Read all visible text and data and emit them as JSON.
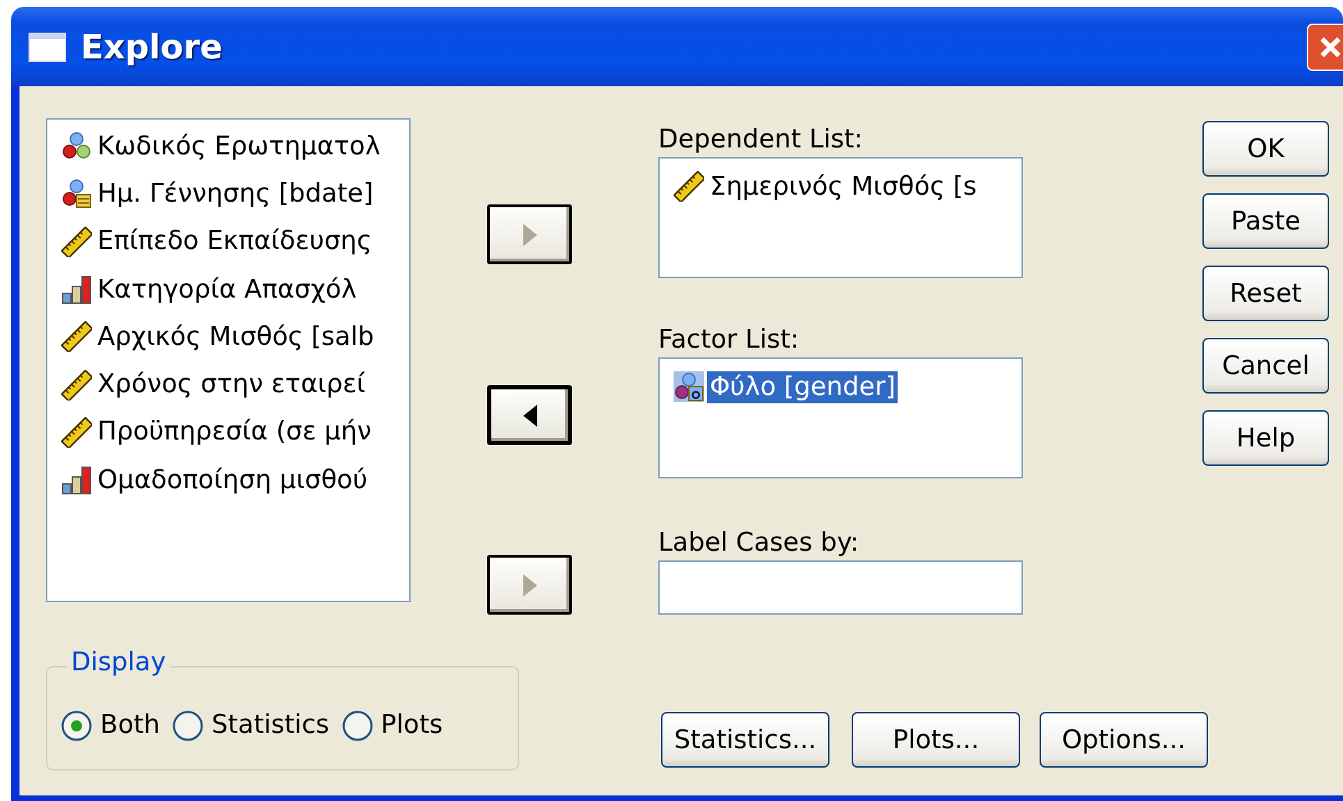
{
  "window": {
    "title": "Explore"
  },
  "source_list": {
    "items": [
      {
        "label": "Κωδικός Ερωτηματολ",
        "kind": "nominal"
      },
      {
        "label": "Ημ. Γέννησης [bdate]",
        "kind": "date"
      },
      {
        "label": "Επίπεδο Εκπαίδευσης",
        "kind": "scale"
      },
      {
        "label": "Κατηγορία Απασχόλ",
        "kind": "ordinal"
      },
      {
        "label": "Αρχικός Μισθός [salb",
        "kind": "scale"
      },
      {
        "label": "Χρόνος στην εταιρεί",
        "kind": "scale"
      },
      {
        "label": "Προϋπηρεσία (σε μήν",
        "kind": "scale"
      },
      {
        "label": "Ομαδοποίηση μισθού",
        "kind": "ordinal"
      }
    ]
  },
  "move_buttons": [
    {
      "kind": "right",
      "disabled": true,
      "default": false
    },
    {
      "kind": "left",
      "disabled": false,
      "default": true
    },
    {
      "kind": "right",
      "disabled": true,
      "default": false
    }
  ],
  "dependent_list": {
    "label": "Dependent List:",
    "items": [
      {
        "label": "Σημερινός Μισθός [s",
        "kind": "scale",
        "selected": false
      }
    ]
  },
  "factor_list": {
    "label": "Factor List:",
    "items": [
      {
        "label": "Φύλο [gender]",
        "kind": "string",
        "selected": true
      }
    ]
  },
  "label_cases": {
    "label": "Label Cases by:"
  },
  "display": {
    "label": "Display",
    "options": [
      {
        "label": "Both",
        "selected": true
      },
      {
        "label": "Statistics",
        "selected": false
      },
      {
        "label": "Plots",
        "selected": false
      }
    ]
  },
  "action_buttons": [
    "OK",
    "Paste",
    "Reset",
    "Cancel",
    "Help"
  ],
  "bottom_buttons": [
    "Statistics...",
    "Plots...",
    "Options..."
  ]
}
